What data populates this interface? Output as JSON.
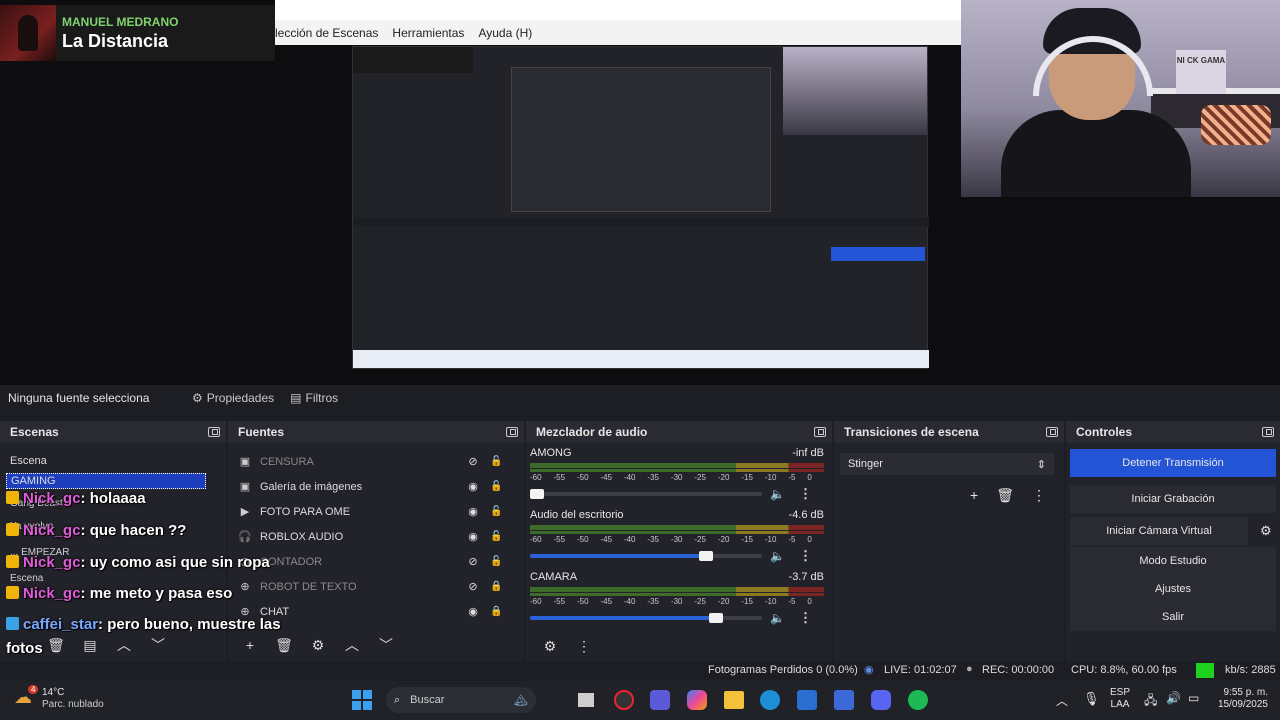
{
  "now_playing": {
    "artist": "MANUEL MEDRANO",
    "song": "La Distancia"
  },
  "menubar": {
    "items": [
      "lección de Escenas",
      "Herramientas",
      "Ayuda (H)"
    ]
  },
  "webcam": {
    "poster": "NI CK GAMA"
  },
  "source_toolbar": {
    "no_source": "Ninguna fuente selecciona",
    "properties": "Propiedades",
    "filters": "Filtros"
  },
  "scenes": {
    "title": "Escenas",
    "items": [
      {
        "label": "Escena"
      },
      {
        "label": "GAMING",
        "selected": true
      },
      {
        "label": "Gang Beast"
      },
      {
        "label": "Ya vuelvo"
      },
      {
        "label": "... EMPEZAR"
      },
      {
        "label": "Escena"
      }
    ]
  },
  "sources": {
    "title": "Fuentes",
    "items": [
      {
        "label": "CENSURA",
        "icon": "image-icon",
        "visible": false,
        "locked": false
      },
      {
        "label": "Galería de imágenes",
        "icon": "image-icon",
        "visible": true,
        "locked": false
      },
      {
        "label": "FOTO PARA OME",
        "icon": "play-icon",
        "visible": true,
        "locked": false
      },
      {
        "label": "ROBLOX AUDIO",
        "icon": "headphones-icon",
        "visible": true,
        "locked": false
      },
      {
        "label": "CONTADOR",
        "icon": "clock-icon",
        "visible": false,
        "locked": false
      },
      {
        "label": "ROBOT DE TEXTO",
        "icon": "globe-icon",
        "visible": false,
        "locked": true
      },
      {
        "label": "CHAT",
        "icon": "globe-icon",
        "visible": true,
        "locked": true
      }
    ]
  },
  "mixer": {
    "title": "Mezclador de audio",
    "scale": [
      "-60",
      "-55",
      "-50",
      "-45",
      "-40",
      "-35",
      "-30",
      "-25",
      "-20",
      "-15",
      "-10",
      "-5",
      "0"
    ],
    "channels": [
      {
        "name": "AMONG",
        "level": "-inf dB",
        "volume": 0.02,
        "muted": false
      },
      {
        "name": "Audio del escritorio",
        "level": "-4.6 dB",
        "volume": 0.76,
        "muted": false
      },
      {
        "name": "CAMARA",
        "level": "-3.7 dB",
        "volume": 0.8,
        "muted": false
      }
    ]
  },
  "transitions": {
    "title": "Transiciones de escena",
    "selected": "Stinger"
  },
  "controls": {
    "title": "Controles",
    "stop_stream": "Detener Transmisión",
    "start_rec": "Iniciar Grabación",
    "virtual_cam": "Iniciar Cámara Virtual",
    "studio": "Modo Estudio",
    "settings": "Ajustes",
    "exit": "Salir"
  },
  "status": {
    "dropped": "Fotogramas Perdidos 0 (0.0%)",
    "live": "LIVE: 01:02:07",
    "rec": "REC: 00:00:00",
    "cpu": "CPU: 8.8%, 60.00 fps",
    "kbs": "kb/s: 2885"
  },
  "chat": [
    {
      "user": "Nick_gc",
      "msg": ": holaaaa",
      "badge": "gold"
    },
    {
      "user": "Nick_gc",
      "msg": ": que hacen ??",
      "badge": "gold"
    },
    {
      "user": "Nick_gc",
      "msg": ": uy como asi que sin ropa",
      "badge": "gold"
    },
    {
      "user": "Nick_gc",
      "msg": ": me meto y pasa eso",
      "badge": "gold"
    },
    {
      "user": "caffei_star",
      "msg": ": pero bueno, muestre las",
      "badge": "blue"
    },
    {
      "user": "",
      "msg": "fotos",
      "badge": ""
    }
  ],
  "taskbar": {
    "temp": "14°C",
    "weather": "Parc. nublado",
    "search": "Buscar",
    "lang": "ESP",
    "region": "LAA",
    "time": "9:55 p. m.",
    "date": "15/09/2025",
    "weather_badge": "4"
  },
  "colors": {
    "accent": "#2454d6",
    "bg": "#1d1e24",
    "dock": "#22232a",
    "chat_user": "#e05bd8",
    "live_green": "#1ed11e"
  }
}
